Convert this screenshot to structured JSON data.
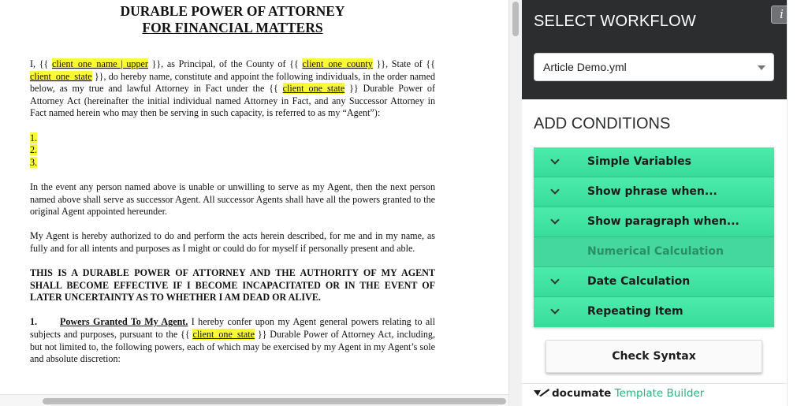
{
  "document": {
    "title1": "DURABLE POWER OF ATTORNEY",
    "title2": "FOR FINANCIAL MATTERS",
    "p1": {
      "t0": "I, {{ ",
      "v0": "client_one_name | upper",
      "t1": " }}, as Principal, of the County of {{ ",
      "v1": "client_one_county",
      "t2": " }}, State of {{ ",
      "v2": "client_one_state",
      "t3": " }}, do hereby name, constitute and appoint the following individuals, in the order named below, as my true and lawful Attorney in Fact under the {{ ",
      "v3": "client_one_state",
      "t4": " }} Durable Power of Attorney Act (hereinafter the initial individual named Attorney in Fact, and any Successor Attorney in Fact named herein who may then be serving in such capacity, is referred to as my “Agent”):"
    },
    "list": [
      "1.",
      "2.",
      "3."
    ],
    "p2": "In the event any person named above is unable or unwilling to serve as my Agent, then the next person named above shall serve as successor Agent.  All successor Agents shall have all the powers granted to the original Agent appointed hereunder.",
    "p3": "My Agent is hereby authorized to do and perform the acts herein described, for me and in my name, as fully and for all intents and purposes as I might or could do for myself if personally present and able.",
    "p4": "THIS IS A DURABLE POWER OF ATTORNEY AND THE AUTHORITY OF MY AGENT SHALL BECOME EFFECTIVE IF I BECOME INCAPACITATED OR IN THE EVENT OF LATER UNCERTAINTY AS TO WHETHER I AM DEAD OR ALIVE.",
    "p5": {
      "num": "1.",
      "heading": "Powers Granted To My Agent.",
      "t0": "  I hereby confer upon my Agent general powers relating to all subjects and purposes, pursuant to the {{ ",
      "v0": "client_one_state",
      "t1": " }} Durable Power of Attorney Act, including, but not limited to, the following powers, each of which may be exercised by my Agent in my Agent’s sole and absolute discretion:"
    }
  },
  "panel": {
    "workflow_title": "SELECT WORKFLOW",
    "info_label": "i",
    "workflow_value": "Article Demo.yml",
    "conditions_title": "ADD CONDITIONS",
    "conditions": [
      {
        "label": "Simple Variables"
      },
      {
        "label": "Show phrase when..."
      },
      {
        "label": "Show paragraph when..."
      },
      {
        "label": "Numerical Calculation"
      },
      {
        "label": "Date Calculation"
      },
      {
        "label": "Repeating Item"
      }
    ],
    "check_label": "Check Syntax",
    "brand_name": "documate",
    "brand_sub": "Template Builder"
  },
  "colors": {
    "accent_green": "#3fe3a1",
    "header_dark": "#2b2d2e",
    "highlight": "#fbfb34"
  }
}
